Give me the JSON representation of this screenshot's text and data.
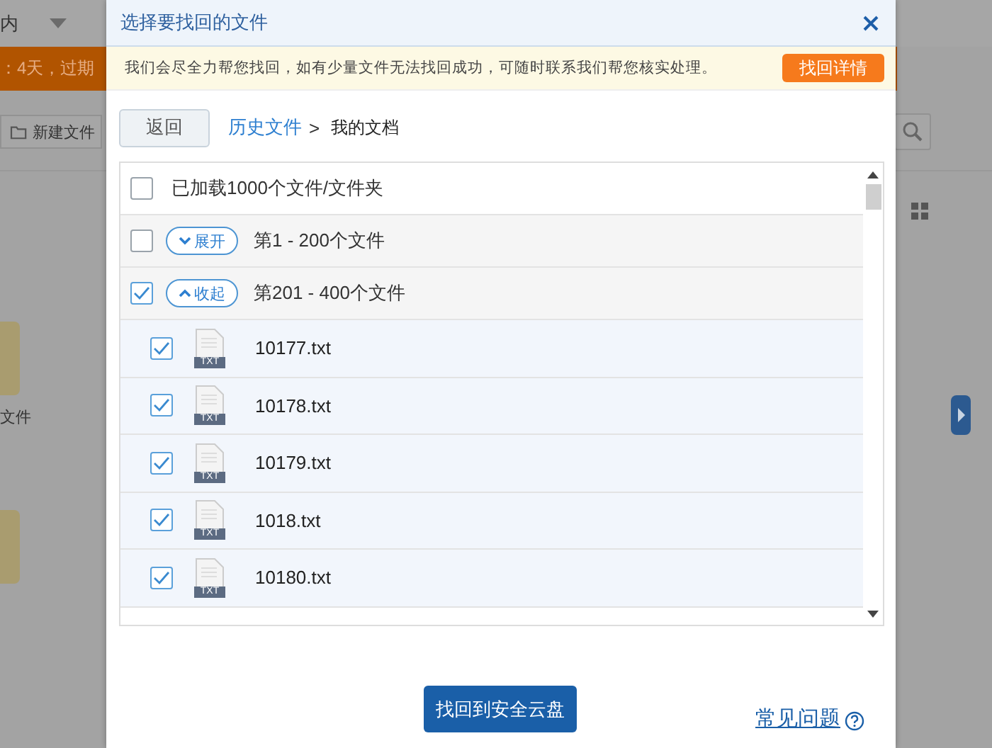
{
  "background": {
    "top_label": "内",
    "expiry_notice": "：4天，过期",
    "new_folder_button": "新建文件",
    "folder_label": "文件"
  },
  "dialog": {
    "title": "选择要找回的文件",
    "notice": "我们会尽全力帮您找回，如有少量文件无法找回成功，可随时联系我们帮您核实处理。",
    "notice_button": "找回详情",
    "back_button": "返回",
    "breadcrumb": [
      {
        "label": "历史文件",
        "kind": "link"
      },
      {
        "label": "我的文档",
        "kind": "current"
      }
    ],
    "breadcrumb_separator": ">",
    "select_all": {
      "label": "已加载1000个文件/文件夹",
      "checked": false
    },
    "groups": [
      {
        "label": "第1 - 200个文件",
        "toggle": "展开",
        "checked": false,
        "expanded": false
      },
      {
        "label": "第201 - 400个文件",
        "toggle": "收起",
        "checked": true,
        "expanded": true,
        "files": [
          {
            "name": "10177.txt",
            "icon_label": "TXT",
            "checked": true
          },
          {
            "name": "10178.txt",
            "icon_label": "TXT",
            "checked": true
          },
          {
            "name": "10179.txt",
            "icon_label": "TXT",
            "checked": true
          },
          {
            "name": "1018.txt",
            "icon_label": "TXT",
            "checked": true
          },
          {
            "name": "10180.txt",
            "icon_label": "TXT",
            "checked": true
          }
        ]
      }
    ],
    "primary_button": "找回到安全云盘",
    "help_link": "常见问题"
  }
}
